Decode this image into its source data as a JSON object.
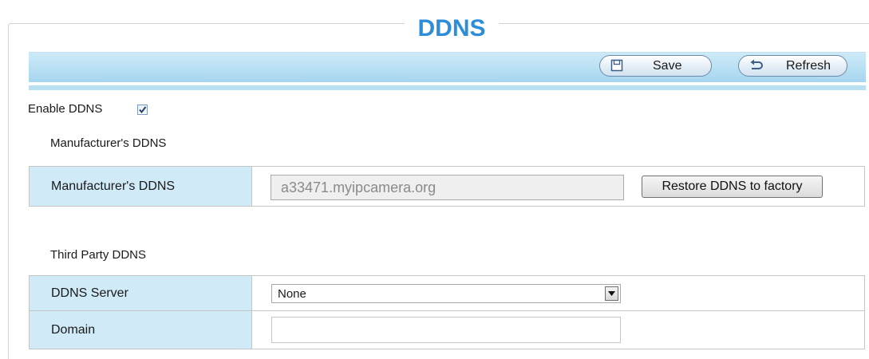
{
  "page": {
    "title": "DDNS"
  },
  "toolbar": {
    "save_label": "Save",
    "refresh_label": "Refresh",
    "save_icon": "floppy-disk-icon",
    "refresh_icon": "refresh-arrow-icon"
  },
  "enable": {
    "label": "Enable DDNS",
    "checked": true
  },
  "manufacturer": {
    "section_label": "Manufacturer's DDNS",
    "row_label": "Manufacturer's DDNS",
    "value": "a33471.myipcamera.org",
    "restore_label": "Restore DDNS to factory"
  },
  "third_party": {
    "section_label": "Third Party DDNS",
    "server_label": "DDNS Server",
    "server_value": "None",
    "domain_label": "Domain",
    "domain_value": ""
  },
  "colors": {
    "title": "#2c8ed8",
    "toolbar": "#a6d6ef",
    "label_cell": "#d0eaf8"
  }
}
